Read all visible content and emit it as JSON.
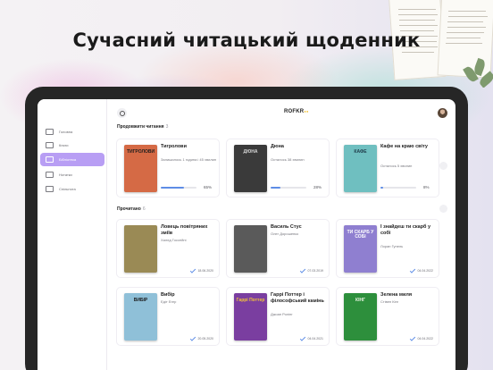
{
  "headline": "Сучасний читацький щоденник",
  "app": {
    "logo": "ROFKR",
    "logo_mark": "●●"
  },
  "sidebar": {
    "items": [
      {
        "label": "Головна",
        "active": false
      },
      {
        "label": "Книги",
        "active": false
      },
      {
        "label": "Бібліотека",
        "active": true
      },
      {
        "label": "Нотатки",
        "active": false
      },
      {
        "label": "Спільнота",
        "active": false
      }
    ]
  },
  "sections": {
    "continue": {
      "title": "Продовжити читання",
      "count": "3"
    },
    "read": {
      "title": "Прочитано",
      "count": "6"
    }
  },
  "continue_books": [
    {
      "title": "Тигролови",
      "meta": "Залишилось 1 година і 45 хвилин",
      "progress": 65,
      "pct_label": "65%",
      "cover_text": "ТИГРОЛОВИ",
      "cover_bg": "#d56a45",
      "cover_fg": "#1d1d1d"
    },
    {
      "title": "Дюна",
      "meta": "Осталось 38 хвилин",
      "progress": 28,
      "pct_label": "28%",
      "cover_text": "ДЮНА",
      "cover_bg": "#3a3a3a",
      "cover_fg": "#d9d9d9"
    },
    {
      "title": "Кафе на краю світу",
      "meta": "Осталось 5 хвилин",
      "progress": 8,
      "pct_label": "8%",
      "cover_text": "КАФЕ",
      "cover_bg": "#6fbfc0",
      "cover_fg": "#1f3c4a"
    }
  ],
  "read_books": [
    {
      "title": "Ловець повітряних зміїв",
      "author": "Халед Госсейні",
      "date": "18.06.2020",
      "cover_text": "",
      "cover_bg": "#9a8a55",
      "cover_fg": "#ffffff"
    },
    {
      "title": "Василь Стус",
      "author": "Олег Дорошенко",
      "date": "07.03.2019",
      "cover_text": "",
      "cover_bg": "#5a5a5a",
      "cover_fg": "#ffffff"
    },
    {
      "title": "І знайдеш ти скарб у собі",
      "author": "Лоран Гунель",
      "date": "04.04.2022",
      "cover_text": "ТИ СКАРБ У СОБІ",
      "cover_bg": "#8f7fd0",
      "cover_fg": "#ffffff"
    },
    {
      "title": "Вибір",
      "author": "Едіт Егер",
      "date": "20.05.2020",
      "cover_text": "ВИБІР",
      "cover_bg": "#8fc0d8",
      "cover_fg": "#1a1a1a"
    },
    {
      "title": "Гаррі Поттер і філософський камінь",
      "author": "Джоан Ролінг",
      "date": "04.04.2021",
      "cover_text": "Гаррі Поттер",
      "cover_bg": "#7a3ea0",
      "cover_fg": "#f2c23a"
    },
    {
      "title": "Зелена миля",
      "author": "Стівен Кінг",
      "date": "04.04.2022",
      "cover_text": "КІНГ",
      "cover_bg": "#2d8f3c",
      "cover_fg": "#e9f5e3"
    }
  ]
}
